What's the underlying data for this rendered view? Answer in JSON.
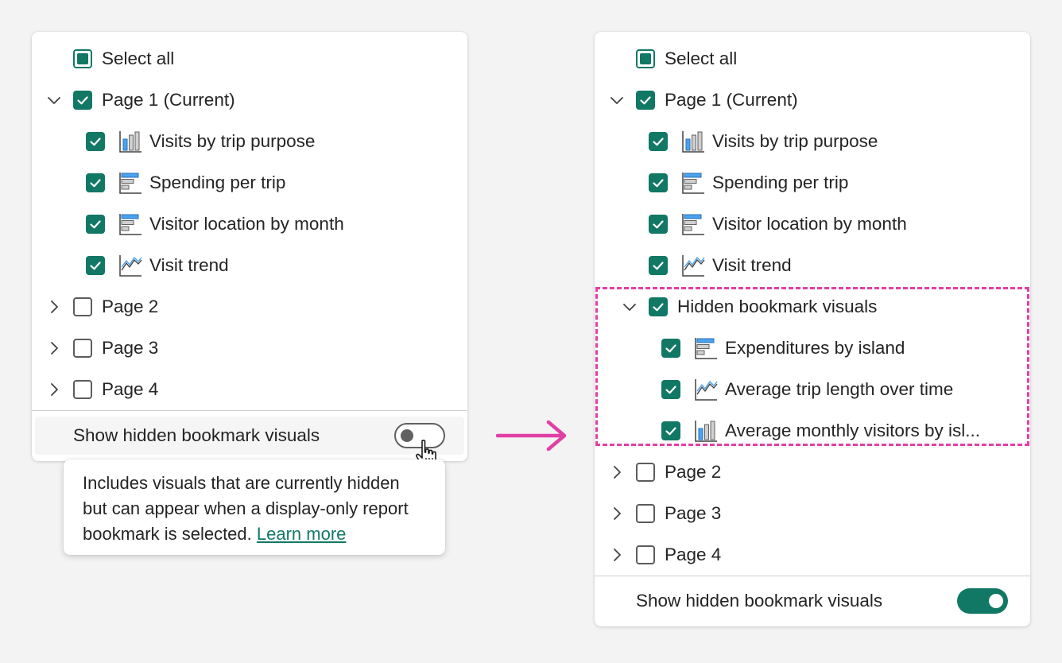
{
  "colors": {
    "accent": "#117865",
    "highlight": "#e23fa6",
    "arrow": "#e23fa6"
  },
  "left_panel": {
    "select_all": "Select all",
    "page1": "Page 1 (Current)",
    "visuals": [
      {
        "label": "Visits by trip purpose",
        "icon": "column-chart-icon"
      },
      {
        "label": "Spending per trip",
        "icon": "bar-chart-icon"
      },
      {
        "label": "Visitor location by month",
        "icon": "bar-chart-icon"
      },
      {
        "label": "Visit trend",
        "icon": "line-chart-icon"
      }
    ],
    "pages": [
      "Page 2",
      "Page 3",
      "Page 4"
    ],
    "toggle_label": "Show hidden bookmark visuals",
    "toggle_state": "off"
  },
  "tooltip": {
    "text": "Includes visuals that are currently hidden but can appear when a display-only report bookmark is selected.",
    "link": "Learn more"
  },
  "right_panel": {
    "select_all": "Select all",
    "page1": "Page 1 (Current)",
    "visuals": [
      {
        "label": "Visits by trip purpose",
        "icon": "column-chart-icon"
      },
      {
        "label": "Spending per trip",
        "icon": "bar-chart-icon"
      },
      {
        "label": "Visitor location by month",
        "icon": "bar-chart-icon"
      },
      {
        "label": "Visit trend",
        "icon": "line-chart-icon"
      }
    ],
    "hidden_group": "Hidden bookmark visuals",
    "hidden_visuals": [
      {
        "label": "Expenditures by island",
        "icon": "bar-chart-icon"
      },
      {
        "label": "Average trip length over time",
        "icon": "line-chart-icon"
      },
      {
        "label": "Average monthly visitors by isl...",
        "icon": "column-chart-icon"
      }
    ],
    "pages": [
      "Page 2",
      "Page 3",
      "Page 4"
    ],
    "toggle_label": "Show hidden bookmark visuals",
    "toggle_state": "on"
  }
}
